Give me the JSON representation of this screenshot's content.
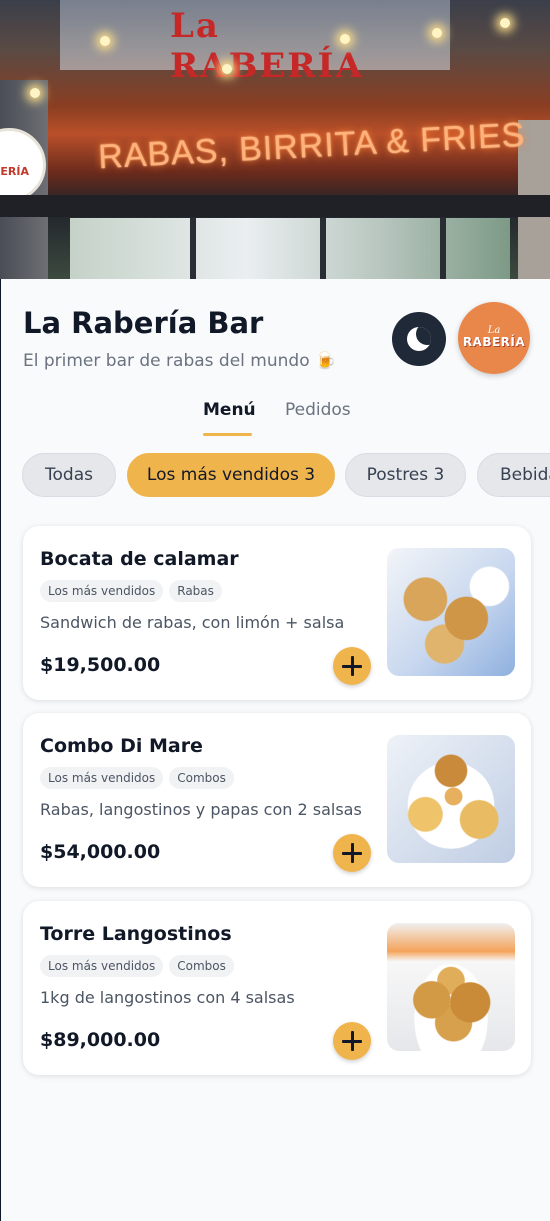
{
  "hero": {
    "sign_top": "La RABERÍA",
    "neon_text": "RABAS, BIRRITA & FRIES",
    "wall_logo": "La RABERÍA"
  },
  "header": {
    "title": "La Rabería Bar",
    "subtitle": "El primer bar de rabas del mundo 🍺",
    "theme_icon": "moon-icon",
    "logo_line1": "La",
    "logo_line2": "RABERÍA"
  },
  "tabs": [
    {
      "label": "Menú",
      "active": true
    },
    {
      "label": "Pedidos",
      "active": false
    }
  ],
  "categories": [
    {
      "label": "Todas",
      "active": false
    },
    {
      "label": "Los más vendidos 3",
      "active": true
    },
    {
      "label": "Postres 3",
      "active": false
    },
    {
      "label": "Bebidas",
      "active": false
    }
  ],
  "products": [
    {
      "name": "Bocata de calamar",
      "tags": [
        "Los más vendidos",
        "Rabas"
      ],
      "description": "Sandwich de rabas, con limón + salsa",
      "price": "$19,500.00"
    },
    {
      "name": "Combo Di Mare",
      "tags": [
        "Los más vendidos",
        "Combos"
      ],
      "description": "Rabas, langostinos y papas con 2 salsas",
      "price": "$54,000.00"
    },
    {
      "name": "Torre Langostinos",
      "tags": [
        "Los más vendidos",
        "Combos"
      ],
      "description": "1kg de langostinos con 4 salsas",
      "price": "$89,000.00"
    }
  ],
  "colors": {
    "accent": "#f0b44c",
    "dark": "#1f2937",
    "logo_bg": "#e9874a"
  }
}
